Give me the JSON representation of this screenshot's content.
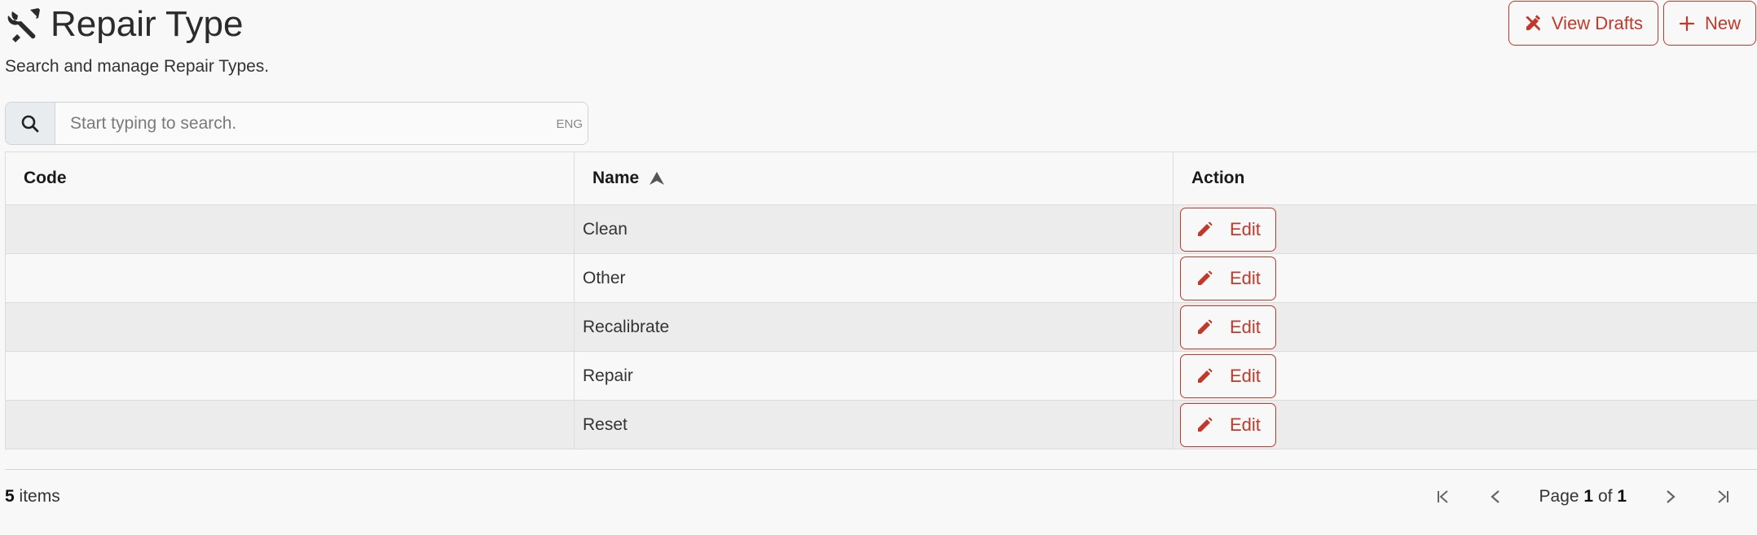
{
  "header": {
    "title": "Repair Type",
    "subtitle": "Search and manage Repair Types.",
    "icon": "tools-icon"
  },
  "actions": {
    "view_drafts_label": "View Drafts",
    "new_label": "New"
  },
  "search": {
    "placeholder": "Start typing to search.",
    "value": "",
    "ime_indicator": "ENG"
  },
  "table": {
    "columns": {
      "code": "Code",
      "name": "Name",
      "action": "Action"
    },
    "sort": {
      "column": "name",
      "direction": "asc"
    },
    "edit_label": "Edit",
    "rows": [
      {
        "code": "",
        "name": "Clean"
      },
      {
        "code": "",
        "name": "Other"
      },
      {
        "code": "",
        "name": "Recalibrate"
      },
      {
        "code": "",
        "name": "Repair"
      },
      {
        "code": "",
        "name": "Reset"
      }
    ]
  },
  "footer": {
    "items_count": "5",
    "items_label": "items",
    "page_label": "Page",
    "current_page": "1",
    "of_label": "of",
    "total_pages": "1"
  },
  "colors": {
    "accent": "#c0392b",
    "row_stripe": "#ececec",
    "background": "#f8f8f8"
  }
}
